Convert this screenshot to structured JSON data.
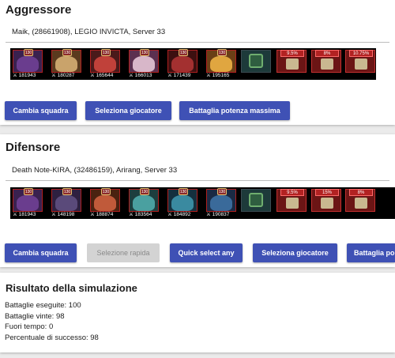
{
  "aggressor": {
    "title": "Aggressore",
    "player_value": "Maik, (28661908), LEGIO INVICTA, Server 33",
    "heroes": [
      {
        "level": "130",
        "power": "181943",
        "color": "#6a3d8e",
        "bg": "#3a214f"
      },
      {
        "level": "130",
        "power": "180287",
        "color": "#c9a36b",
        "bg": "#5a3a1e"
      },
      {
        "level": "130",
        "power": "165644",
        "color": "#c0413a",
        "bg": "#4a1a1a"
      },
      {
        "level": "130",
        "power": "166013",
        "color": "#d8b7c9",
        "bg": "#5c3050"
      },
      {
        "level": "130",
        "power": "171439",
        "color": "#a33030",
        "bg": "#3d1010"
      },
      {
        "level": "130",
        "power": "195165",
        "color": "#e0a640",
        "bg": "#6a3f16"
      }
    ],
    "pet_icon": "pet-icon",
    "buffs": [
      {
        "pct": "9.5%"
      },
      {
        "pct": "8%"
      },
      {
        "pct": "10.75%"
      }
    ],
    "buttons": {
      "change_team": "Cambia squadra",
      "select_player": "Seleziona giocatore",
      "max_power_battle": "Battaglia potenza massima"
    }
  },
  "defender": {
    "title": "Difensore",
    "player_value": "Death Note-KIRA, (32486159), Arirang, Server 33",
    "heroes": [
      {
        "level": "130",
        "power": "181943",
        "color": "#6a3d8e",
        "bg": "#3a214f"
      },
      {
        "level": "130",
        "power": "148198",
        "color": "#5a4a7a",
        "bg": "#2e2040"
      },
      {
        "level": "130",
        "power": "188874",
        "color": "#c05a3a",
        "bg": "#4a2210"
      },
      {
        "level": "130",
        "power": "183564",
        "color": "#4aa0a0",
        "bg": "#1d3e3e"
      },
      {
        "level": "130",
        "power": "184892",
        "color": "#3a8aa0",
        "bg": "#14303e"
      },
      {
        "level": "130",
        "power": "190837",
        "color": "#3a6a9a",
        "bg": "#1a2a44"
      }
    ],
    "pet_icon": "pet-icon",
    "buffs": [
      {
        "pct": "9.5%"
      },
      {
        "pct": "15%"
      },
      {
        "pct": "8%"
      }
    ],
    "buttons": {
      "change_team": "Cambia squadra",
      "quick_select": "Selezione rapida",
      "quick_select_any": "Quick select any",
      "select_player": "Seleziona giocatore",
      "battle_truncated": "Battaglia po"
    }
  },
  "result": {
    "title": "Risultato della simulazione",
    "battles_run": "Battaglie eseguite: 100",
    "battles_won": "Battaglie vinte: 98",
    "timeout": "Fuori tempo: 0",
    "success_pct": "Percentuale di successo: 98"
  },
  "colors": {
    "primary": "#3f51b5",
    "disabled": "#d3d3d3",
    "buff_red": "#b22222"
  }
}
